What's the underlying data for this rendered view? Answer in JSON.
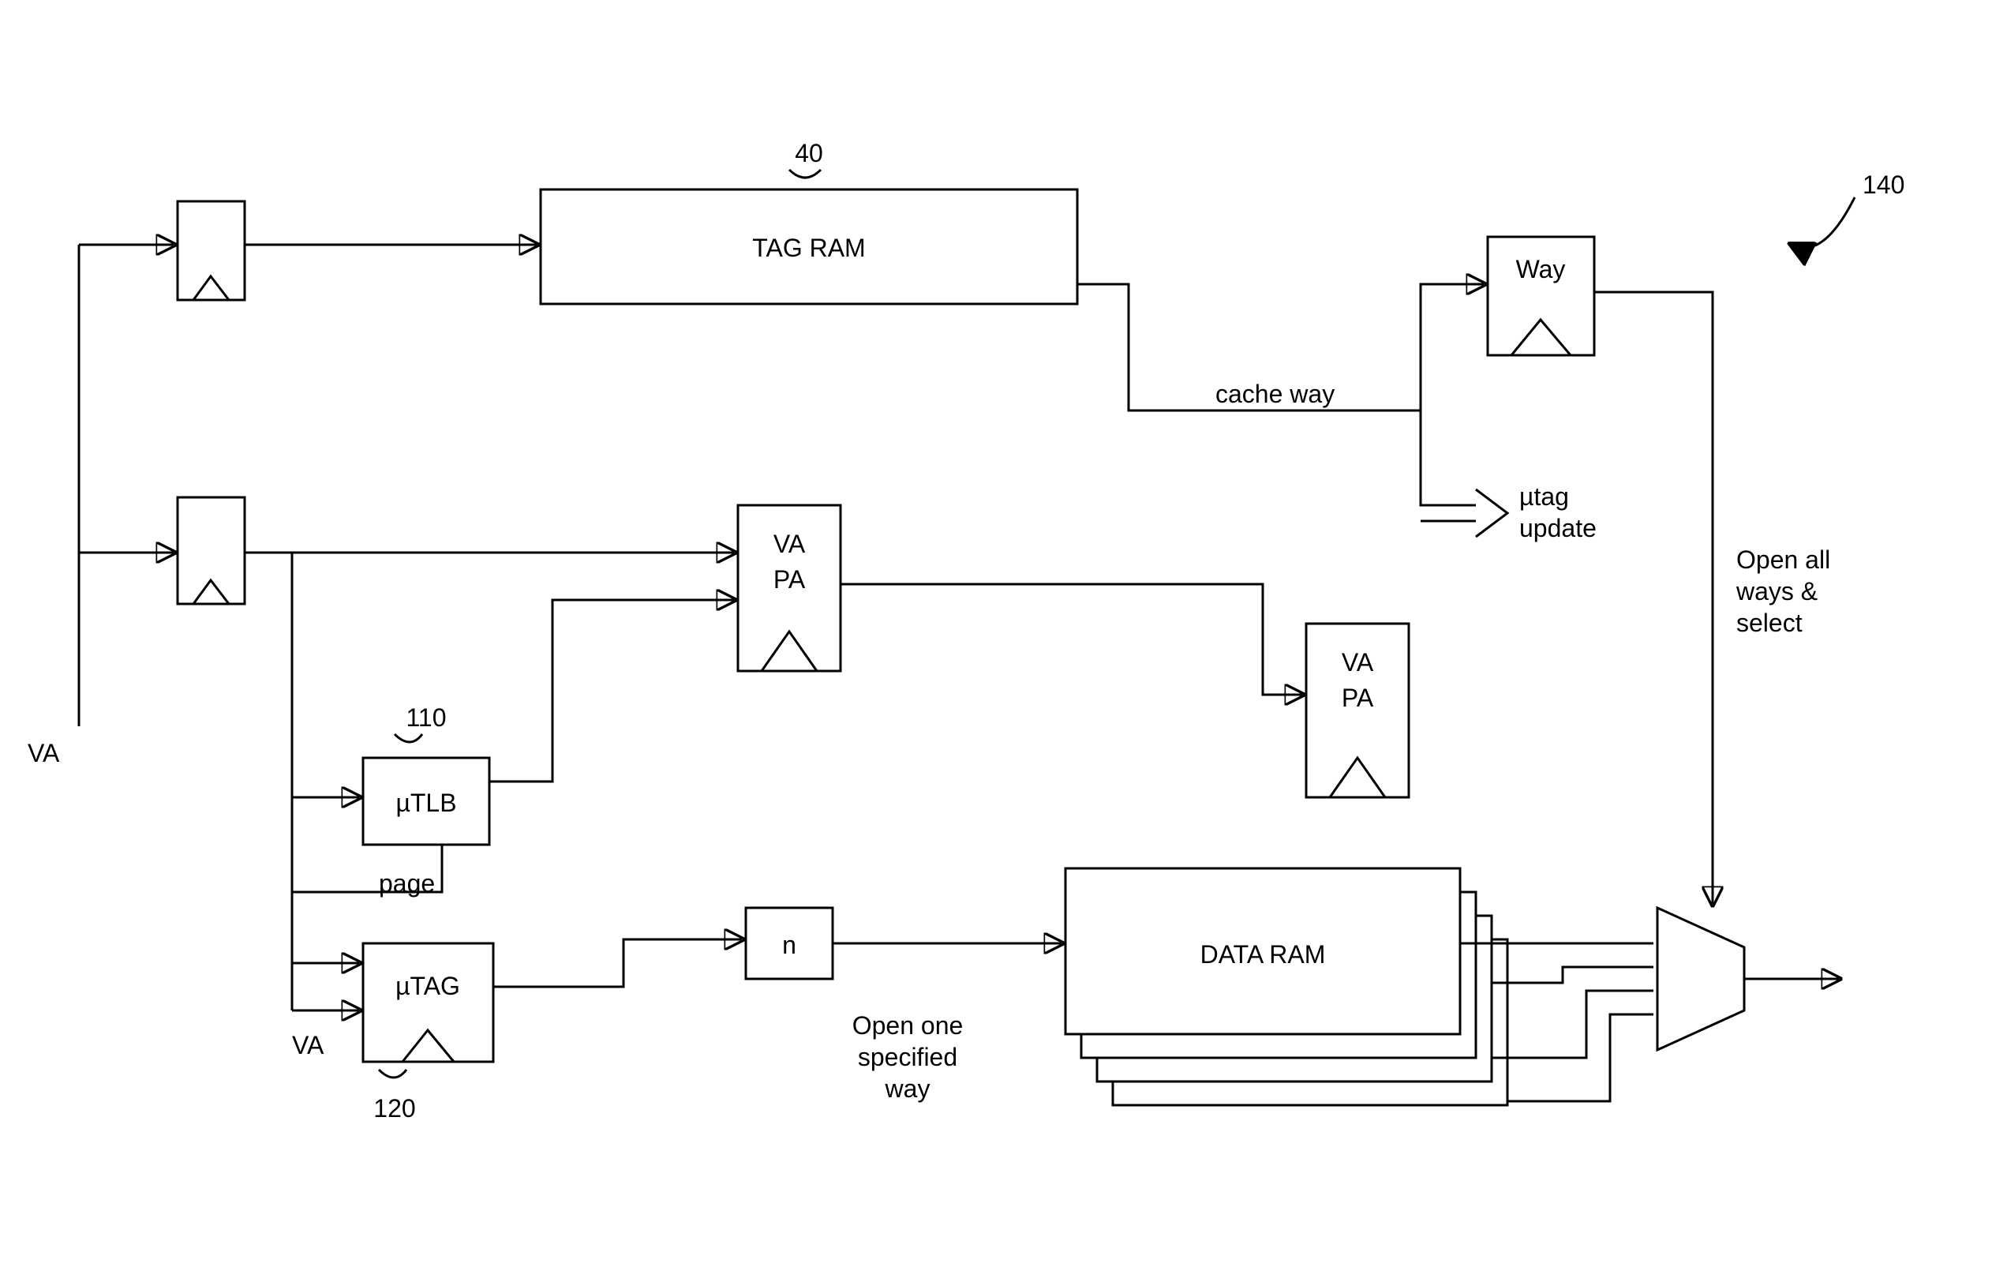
{
  "diagram": {
    "input_label": "VA",
    "tag_ram": {
      "label": "TAG RAM",
      "ref": "40"
    },
    "utlb": {
      "label": "µTLB",
      "ref": "110",
      "out_label": "page"
    },
    "utag": {
      "label": "µTAG",
      "ref": "120",
      "in_label": "VA"
    },
    "vapa1": {
      "line1": "VA",
      "line2": "PA"
    },
    "vapa2": {
      "line1": "VA",
      "line2": "PA"
    },
    "nbox": {
      "label": "n"
    },
    "open_one": {
      "line1": "Open one",
      "line2": "specified",
      "line3": "way"
    },
    "data_ram": {
      "label": "DATA RAM"
    },
    "cache_way_label": "cache way",
    "utag_update": {
      "line1": "µtag",
      "line2": "update"
    },
    "way_reg": {
      "label": "Way"
    },
    "mux_ref": "140",
    "open_all": {
      "line1": "Open all",
      "line2": "ways &",
      "line3": "select"
    }
  }
}
